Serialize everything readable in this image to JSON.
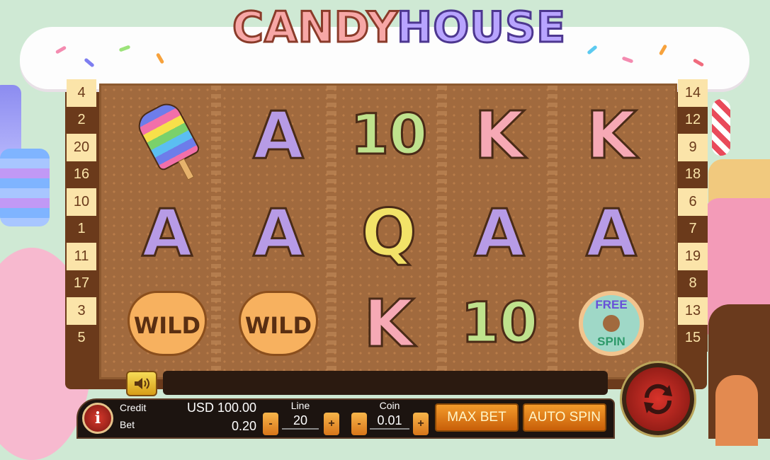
{
  "title": {
    "word1": "CANDY",
    "word2": "HOUSE"
  },
  "paylines_left": [
    "4",
    "2",
    "20",
    "16",
    "10",
    "1",
    "11",
    "17",
    "3",
    "5"
  ],
  "paylines_right": [
    "14",
    "12",
    "9",
    "18",
    "6",
    "7",
    "19",
    "8",
    "13",
    "15"
  ],
  "reels": [
    [
      {
        "type": "popsicle"
      },
      {
        "type": "A"
      },
      {
        "type": "WILD"
      }
    ],
    [
      {
        "type": "A"
      },
      {
        "type": "A"
      },
      {
        "type": "WILD"
      }
    ],
    [
      {
        "type": "10"
      },
      {
        "type": "Q"
      },
      {
        "type": "K"
      }
    ],
    [
      {
        "type": "K"
      },
      {
        "type": "A"
      },
      {
        "type": "10"
      }
    ],
    [
      {
        "type": "K"
      },
      {
        "type": "A"
      },
      {
        "type": "FREE SPIN"
      }
    ]
  ],
  "symbol_labels": {
    "wild": "WILD",
    "free1": "FREE",
    "free2": "SPIN"
  },
  "controls": {
    "credit_label": "Credit",
    "credit_value": "USD 100.00",
    "bet_label": "Bet",
    "bet_value": "0.20",
    "line_label": "Line",
    "line_value": "20",
    "coin_label": "Coin",
    "coin_value": "0.01",
    "minus": "-",
    "plus": "+",
    "max_bet": "MAX BET",
    "auto_spin": "AUTO SPIN",
    "info": "i"
  },
  "icons": {
    "sound": "speaker-icon",
    "spin": "refresh-arrows-icon",
    "info": "info-icon"
  },
  "colors": {
    "frame": "#6b3a1b",
    "reel_bg": "#a16a3e",
    "accent": "#f39b2b",
    "spin": "#d9332a"
  }
}
